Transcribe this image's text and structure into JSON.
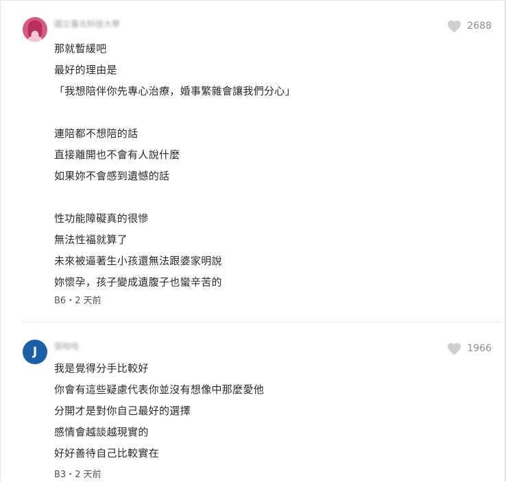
{
  "comments": [
    {
      "author": "國立臺北科技大學",
      "avatar_type": "female-avatar",
      "avatar_color": "#d85a7e",
      "likes": "2688",
      "lines": [
        "那就暫緩吧",
        "最好的理由是",
        "「我想陪伴你先專心治療，婚事繁雜會讓我們分心」",
        "",
        "連陪都不想陪的話",
        "直接離開也不會有人說什麼",
        "如果妳不會感到遺憾的話",
        "",
        "性功能障礙真的很慘",
        "無法性福就算了",
        "未來被逼著生小孩還無法跟婆家明說",
        "妳懷孕，孩子變成遺腹子也蠻辛苦的"
      ],
      "floor": "B6",
      "separator": "・",
      "time": "2 天前"
    },
    {
      "author": "張哈哈",
      "avatar_letter": "J",
      "avatar_color": "#1a5fa8",
      "likes": "1966",
      "lines": [
        "我是覺得分手比較好",
        "你會有這些疑慮代表你並沒有想像中那麼愛他",
        "分開才是對你自己最好的選擇",
        "感情會越談越現實的",
        "好好善待自己比較實在"
      ],
      "floor": "B3",
      "separator": "・",
      "time": "2 天前"
    }
  ],
  "colors": {
    "heart": "#cfcfcf",
    "like_count": "#8c8c8c",
    "divider": "#e6e6e6"
  }
}
